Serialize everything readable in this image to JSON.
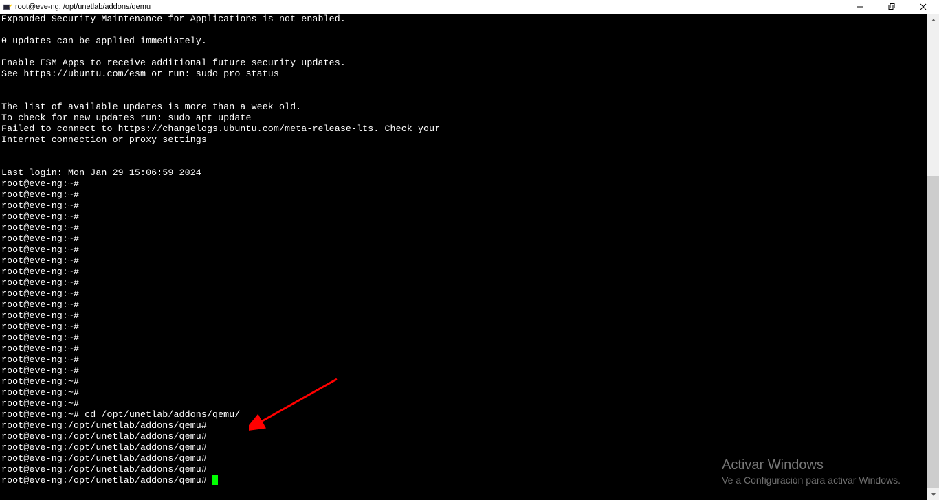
{
  "window": {
    "title": "root@eve-ng: /opt/unetlab/addons/qemu"
  },
  "terminal": {
    "lines": [
      "Expanded Security Maintenance for Applications is not enabled.",
      "",
      "0 updates can be applied immediately.",
      "",
      "Enable ESM Apps to receive additional future security updates.",
      "See https://ubuntu.com/esm or run: sudo pro status",
      "",
      "",
      "The list of available updates is more than a week old.",
      "To check for new updates run: sudo apt update",
      "Failed to connect to https://changelogs.ubuntu.com/meta-release-lts. Check your",
      "Internet connection or proxy settings",
      "",
      "",
      "Last login: Mon Jan 29 15:06:59 2024",
      "root@eve-ng:~#",
      "root@eve-ng:~#",
      "root@eve-ng:~#",
      "root@eve-ng:~#",
      "root@eve-ng:~#",
      "root@eve-ng:~#",
      "root@eve-ng:~#",
      "root@eve-ng:~#",
      "root@eve-ng:~#",
      "root@eve-ng:~#",
      "root@eve-ng:~#",
      "root@eve-ng:~#",
      "root@eve-ng:~#",
      "root@eve-ng:~#",
      "root@eve-ng:~#",
      "root@eve-ng:~#",
      "root@eve-ng:~#",
      "root@eve-ng:~#",
      "root@eve-ng:~#",
      "root@eve-ng:~#",
      "root@eve-ng:~#",
      "root@eve-ng:~# cd /opt/unetlab/addons/qemu/",
      "root@eve-ng:/opt/unetlab/addons/qemu#",
      "root@eve-ng:/opt/unetlab/addons/qemu#",
      "root@eve-ng:/opt/unetlab/addons/qemu#",
      "root@eve-ng:/opt/unetlab/addons/qemu#",
      "root@eve-ng:/opt/unetlab/addons/qemu#"
    ],
    "current_prompt": "root@eve-ng:/opt/unetlab/addons/qemu# "
  },
  "watermark": {
    "title": "Activar Windows",
    "subtitle": "Ve a Configuración para activar Windows."
  }
}
